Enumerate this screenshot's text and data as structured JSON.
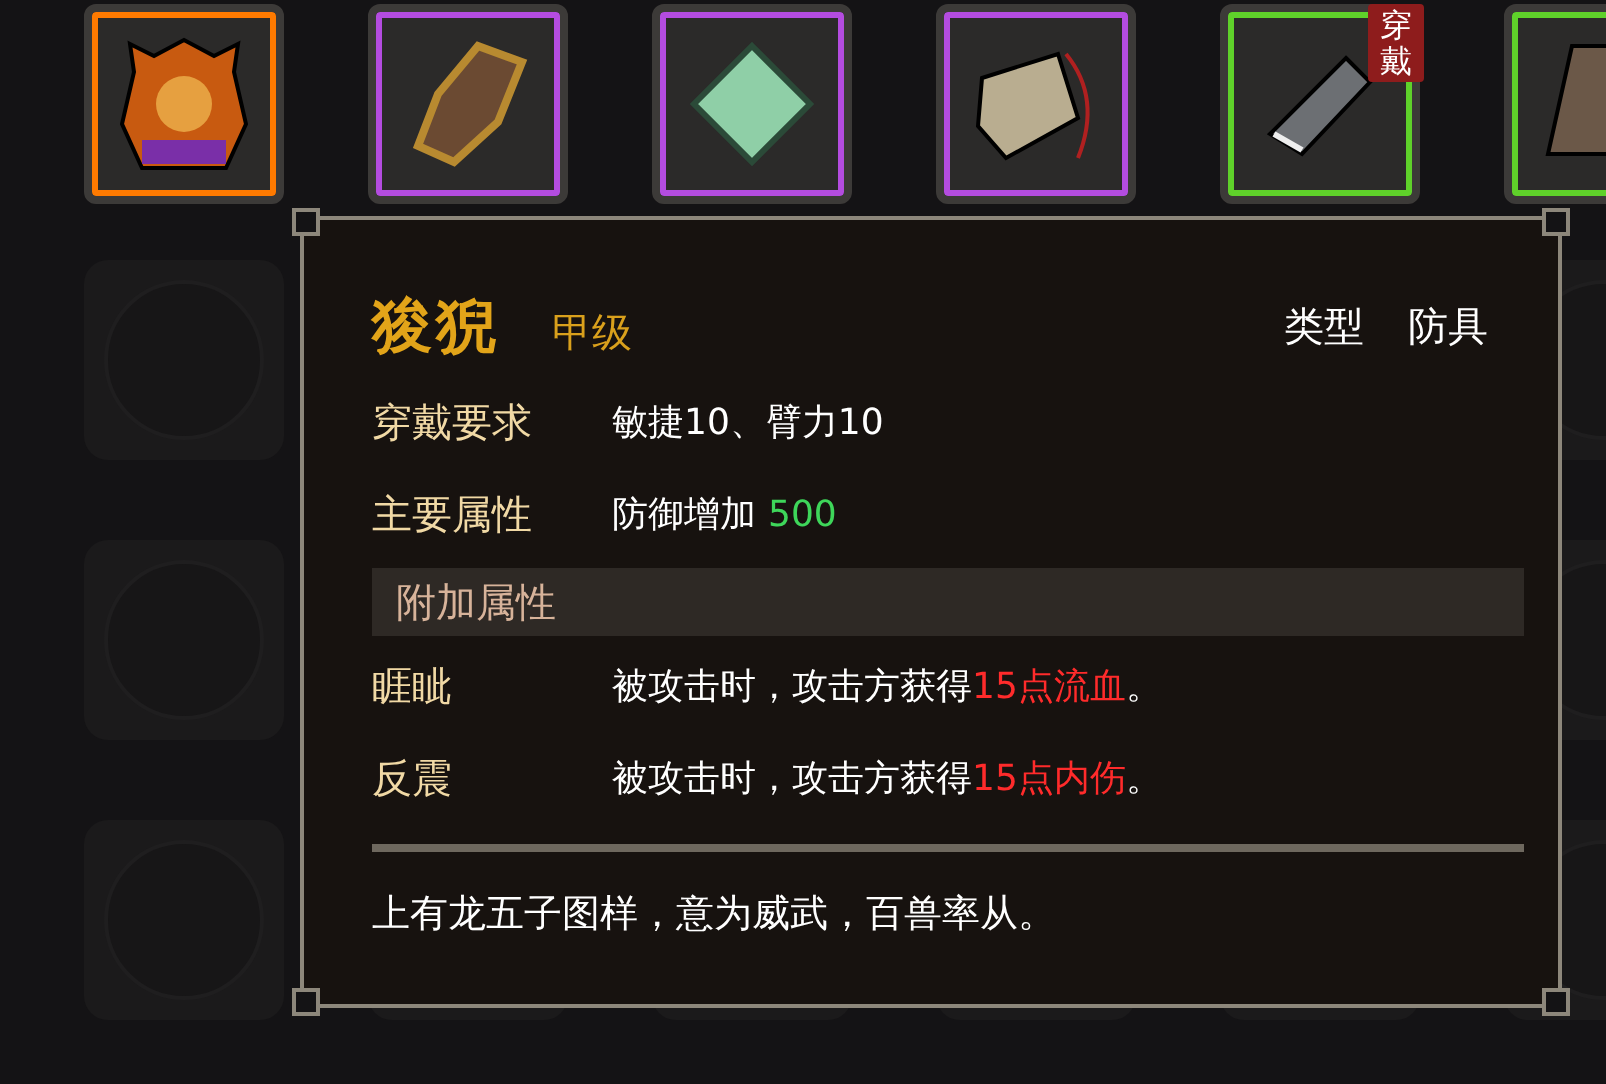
{
  "slots": [
    {
      "kind": "armor",
      "color": "#ff7a00"
    },
    {
      "kind": "bracer",
      "color": "#b44ce0"
    },
    {
      "kind": "jade",
      "color": "#b44ce0"
    },
    {
      "kind": "tablet",
      "color": "#b44ce0"
    },
    {
      "kind": "cleaver",
      "color": "#5fd12a",
      "badge": "穿戴"
    },
    {
      "kind": "robe",
      "color": "#5fd12a"
    }
  ],
  "tooltip": {
    "name": "狻猊",
    "grade": "甲级",
    "type_label": "类型",
    "type_value": "防具",
    "stats": [
      {
        "label": "穿戴要求",
        "parts": [
          {
            "text": "敏捷10、臂力10",
            "kind": "plain"
          }
        ]
      },
      {
        "label": "主要属性",
        "parts": [
          {
            "text": "防御增加",
            "kind": "plain"
          },
          {
            "text": "500",
            "kind": "bonus"
          }
        ]
      }
    ],
    "extra_header": "附加属性",
    "effects": [
      {
        "name": "睚眦",
        "parts": [
          {
            "text": "被攻击时，攻击方获得",
            "kind": "plain"
          },
          {
            "text": "15点流血",
            "kind": "damage"
          },
          {
            "text": "。",
            "kind": "plain"
          }
        ]
      },
      {
        "name": "反震",
        "parts": [
          {
            "text": "被攻击时，攻击方获得",
            "kind": "plain"
          },
          {
            "text": "15点内伤",
            "kind": "damage"
          },
          {
            "text": "。",
            "kind": "plain"
          }
        ]
      }
    ],
    "description": "上有龙五子图样，意为威武，百兽率从。"
  }
}
